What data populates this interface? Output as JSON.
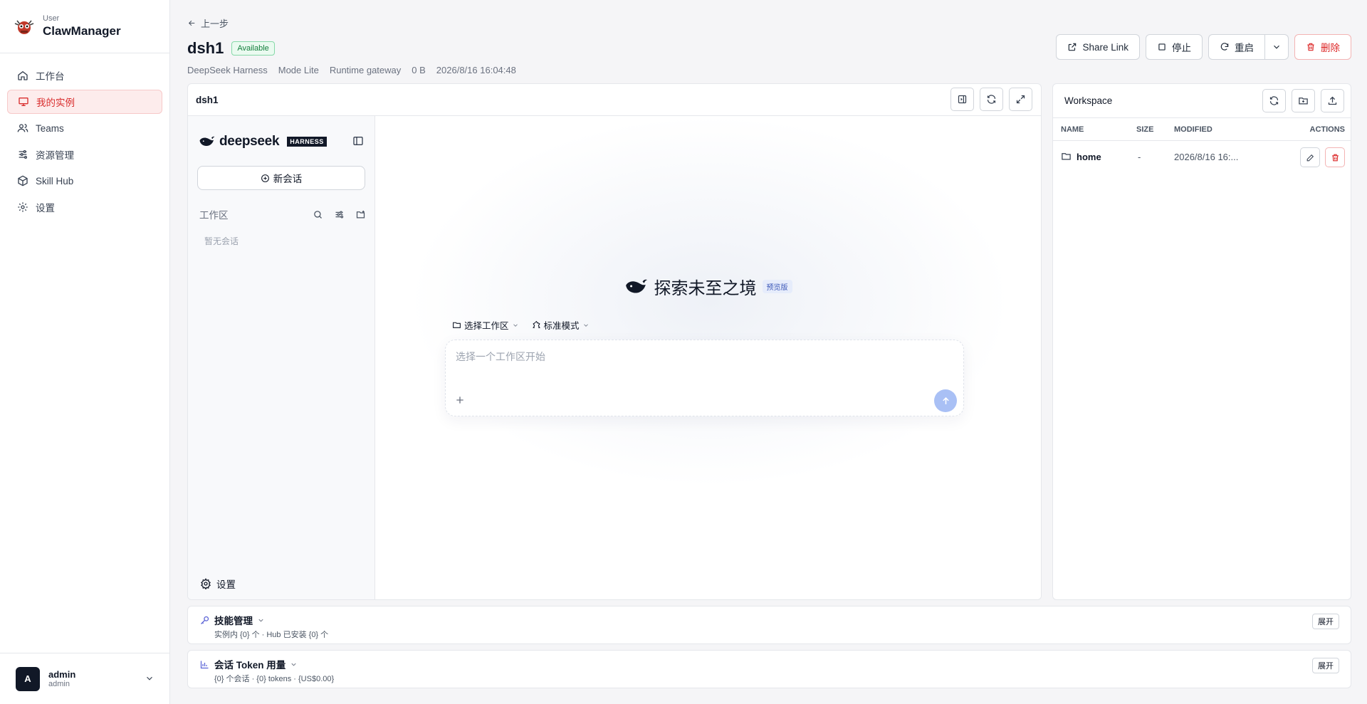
{
  "sidebar": {
    "brand_sub": "User",
    "brand_name": "ClawManager",
    "items": [
      {
        "label": "工作台",
        "icon": "home-icon"
      },
      {
        "label": "我的实例",
        "icon": "monitor-icon"
      },
      {
        "label": "Teams",
        "icon": "users-icon"
      },
      {
        "label": "资源管理",
        "icon": "sliders-icon"
      },
      {
        "label": "Skill Hub",
        "icon": "package-icon"
      },
      {
        "label": "设置",
        "icon": "gear-icon"
      }
    ],
    "active_index": 1,
    "user": {
      "initial": "A",
      "name": "admin",
      "role": "admin"
    }
  },
  "header": {
    "back_label": "上一步",
    "title": "dsh1",
    "status": "Available",
    "meta": [
      "DeepSeek Harness",
      "Mode Lite",
      "Runtime gateway",
      "0 B",
      "2026/8/16 16:04:48"
    ],
    "actions": {
      "share": "Share Link",
      "stop": "停止",
      "restart": "重启",
      "delete": "删除"
    }
  },
  "panel": {
    "title": "dsh1",
    "ds": {
      "logo_text": "deepseek",
      "harness_tag": "HARNESS",
      "new_chat": "新会话",
      "workspace_label": "工作区",
      "empty_text": "暂无会话",
      "settings_label": "设置",
      "hero_text": "探索未至之境",
      "preview_tag": "预览版",
      "chip_workspace": "选择工作区",
      "chip_mode": "标准模式",
      "input_placeholder": "选择一个工作区开始"
    }
  },
  "workspace": {
    "title": "Workspace",
    "columns": [
      "NAME",
      "SIZE",
      "MODIFIED",
      "ACTIONS"
    ],
    "rows": [
      {
        "name": "home",
        "size": "-",
        "modified": "2026/8/16 16:..."
      }
    ]
  },
  "sections": {
    "skills": {
      "title": "技能管理",
      "sub": "实例内 {0} 个 · Hub 已安装 {0} 个",
      "button": "展开"
    },
    "tokens": {
      "title": "会话 Token 用量",
      "sub": "{0} 个会话 · {0} tokens · {US$0.00}",
      "button": "展开"
    }
  },
  "colors": {
    "accent": "#d92d2d",
    "success": "#15803d",
    "send": "#a9c0f5",
    "section_icon": "#5b63d6"
  }
}
